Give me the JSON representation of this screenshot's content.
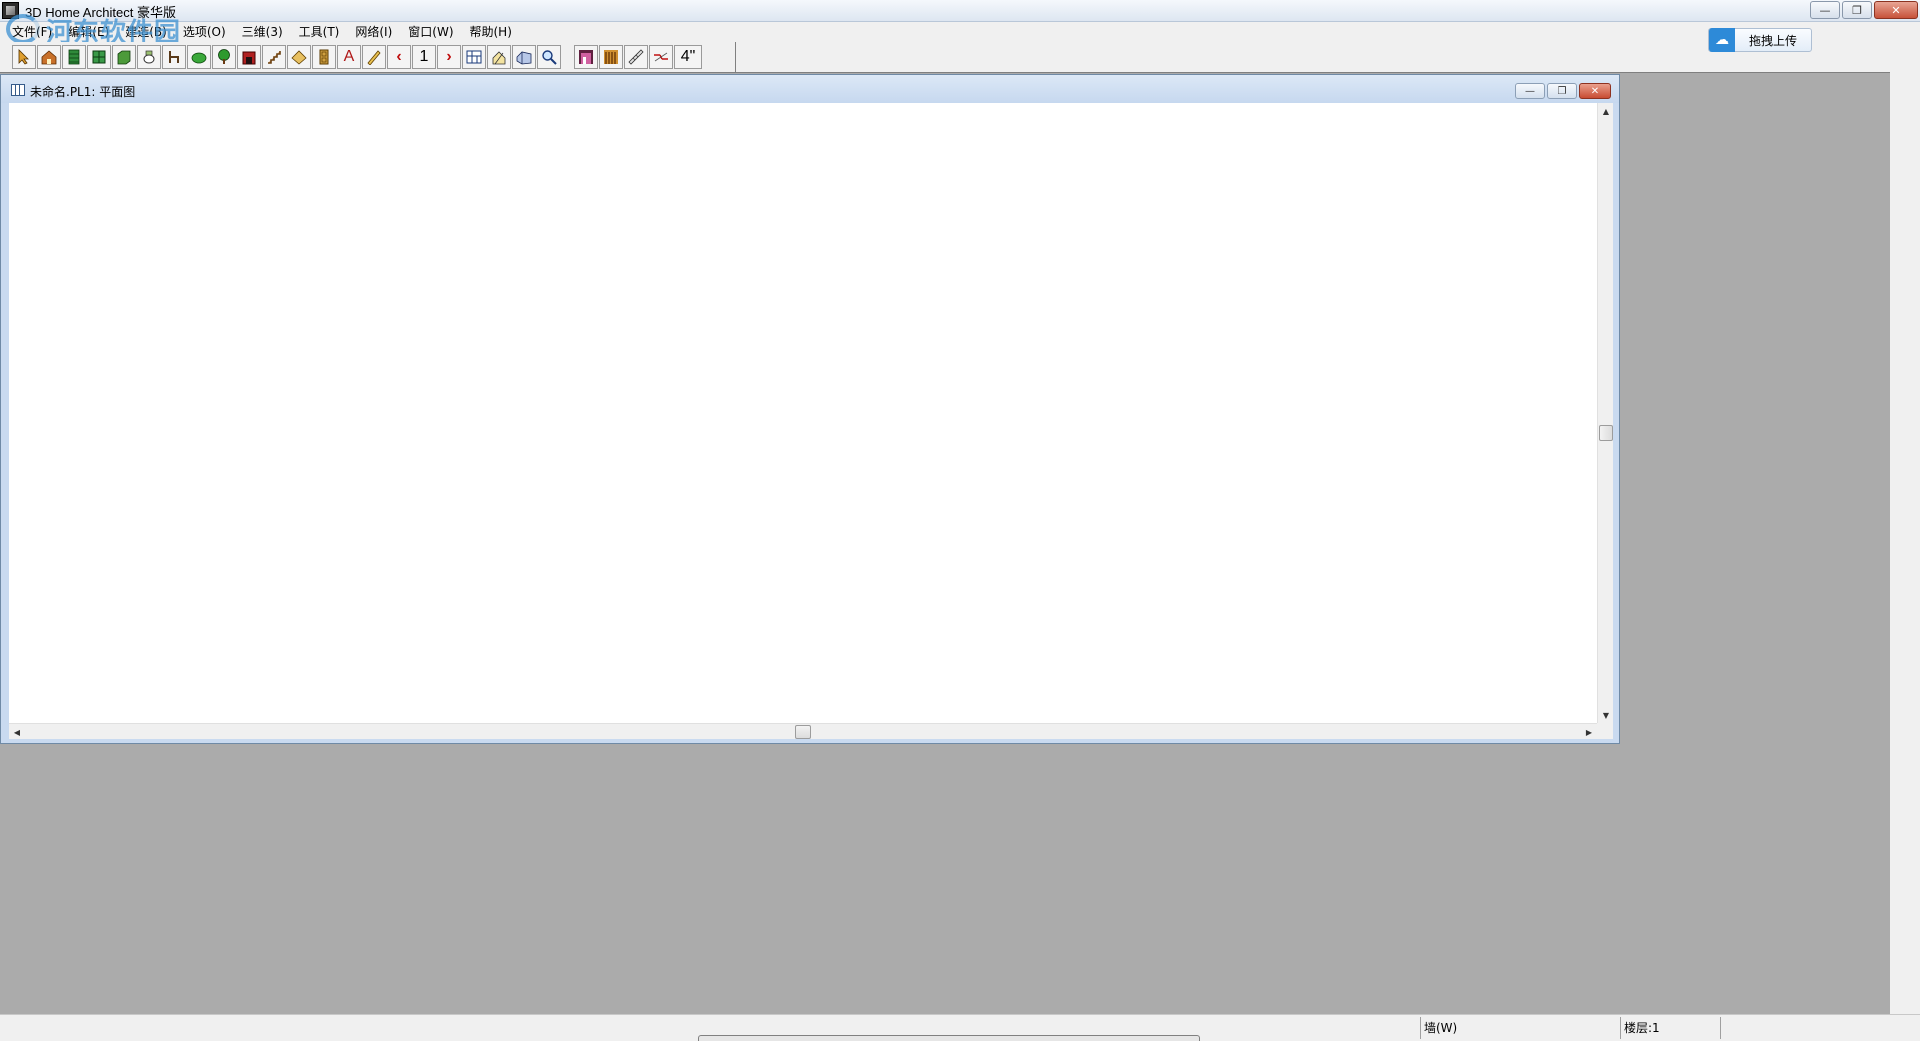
{
  "app": {
    "title": "3D Home Architect 豪华版",
    "controls": {
      "minimize": "—",
      "restore": "❐",
      "close": "✕"
    }
  },
  "watermark": {
    "text": "河东软件园"
  },
  "menu": [
    {
      "label": "文件(F)"
    },
    {
      "label": "编辑(E)"
    },
    {
      "label": "建造(B)"
    },
    {
      "label": "选项(O)"
    },
    {
      "label": "三维(3)"
    },
    {
      "label": "工具(T)"
    },
    {
      "label": "网络(I)"
    },
    {
      "label": "窗口(W)"
    },
    {
      "label": "帮助(H)"
    }
  ],
  "toolbar": {
    "floor_prev": "‹",
    "floor_number": "1",
    "floor_next": "›",
    "text_tool": "A",
    "wall_thickness": "4\""
  },
  "upload": {
    "label": "拖拽上传",
    "icon": "cloud-icon"
  },
  "child_window": {
    "title": "未命名.PL1: 平面图",
    "controls": {
      "minimize": "—",
      "restore": "❐",
      "close": "✕"
    }
  },
  "scrollbars": {
    "up": "▲",
    "down": "▼",
    "left": "◀",
    "right": "▶"
  },
  "status": {
    "mode": "墙(W)",
    "floor": "楼层:1",
    "blank": ""
  },
  "colors": {
    "mdi_background": "#ababab",
    "window_frame": "#c9daf0",
    "accent_blue": "#2d8ad8"
  }
}
